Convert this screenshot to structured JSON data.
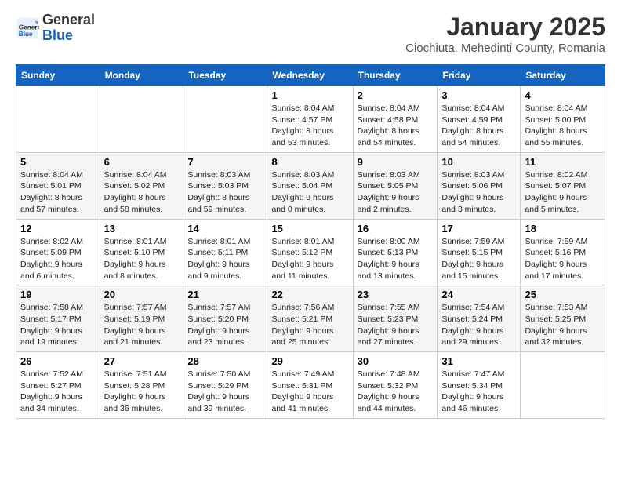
{
  "header": {
    "logo_line1": "General",
    "logo_line2": "Blue",
    "title": "January 2025",
    "subtitle": "Ciochiuta, Mehedinti County, Romania"
  },
  "days_of_week": [
    "Sunday",
    "Monday",
    "Tuesday",
    "Wednesday",
    "Thursday",
    "Friday",
    "Saturday"
  ],
  "weeks": [
    [
      {
        "day": "",
        "info": ""
      },
      {
        "day": "",
        "info": ""
      },
      {
        "day": "",
        "info": ""
      },
      {
        "day": "1",
        "info": "Sunrise: 8:04 AM\nSunset: 4:57 PM\nDaylight: 8 hours\nand 53 minutes."
      },
      {
        "day": "2",
        "info": "Sunrise: 8:04 AM\nSunset: 4:58 PM\nDaylight: 8 hours\nand 54 minutes."
      },
      {
        "day": "3",
        "info": "Sunrise: 8:04 AM\nSunset: 4:59 PM\nDaylight: 8 hours\nand 54 minutes."
      },
      {
        "day": "4",
        "info": "Sunrise: 8:04 AM\nSunset: 5:00 PM\nDaylight: 8 hours\nand 55 minutes."
      }
    ],
    [
      {
        "day": "5",
        "info": "Sunrise: 8:04 AM\nSunset: 5:01 PM\nDaylight: 8 hours\nand 57 minutes."
      },
      {
        "day": "6",
        "info": "Sunrise: 8:04 AM\nSunset: 5:02 PM\nDaylight: 8 hours\nand 58 minutes."
      },
      {
        "day": "7",
        "info": "Sunrise: 8:03 AM\nSunset: 5:03 PM\nDaylight: 8 hours\nand 59 minutes."
      },
      {
        "day": "8",
        "info": "Sunrise: 8:03 AM\nSunset: 5:04 PM\nDaylight: 9 hours\nand 0 minutes."
      },
      {
        "day": "9",
        "info": "Sunrise: 8:03 AM\nSunset: 5:05 PM\nDaylight: 9 hours\nand 2 minutes."
      },
      {
        "day": "10",
        "info": "Sunrise: 8:03 AM\nSunset: 5:06 PM\nDaylight: 9 hours\nand 3 minutes."
      },
      {
        "day": "11",
        "info": "Sunrise: 8:02 AM\nSunset: 5:07 PM\nDaylight: 9 hours\nand 5 minutes."
      }
    ],
    [
      {
        "day": "12",
        "info": "Sunrise: 8:02 AM\nSunset: 5:09 PM\nDaylight: 9 hours\nand 6 minutes."
      },
      {
        "day": "13",
        "info": "Sunrise: 8:01 AM\nSunset: 5:10 PM\nDaylight: 9 hours\nand 8 minutes."
      },
      {
        "day": "14",
        "info": "Sunrise: 8:01 AM\nSunset: 5:11 PM\nDaylight: 9 hours\nand 9 minutes."
      },
      {
        "day": "15",
        "info": "Sunrise: 8:01 AM\nSunset: 5:12 PM\nDaylight: 9 hours\nand 11 minutes."
      },
      {
        "day": "16",
        "info": "Sunrise: 8:00 AM\nSunset: 5:13 PM\nDaylight: 9 hours\nand 13 minutes."
      },
      {
        "day": "17",
        "info": "Sunrise: 7:59 AM\nSunset: 5:15 PM\nDaylight: 9 hours\nand 15 minutes."
      },
      {
        "day": "18",
        "info": "Sunrise: 7:59 AM\nSunset: 5:16 PM\nDaylight: 9 hours\nand 17 minutes."
      }
    ],
    [
      {
        "day": "19",
        "info": "Sunrise: 7:58 AM\nSunset: 5:17 PM\nDaylight: 9 hours\nand 19 minutes."
      },
      {
        "day": "20",
        "info": "Sunrise: 7:57 AM\nSunset: 5:19 PM\nDaylight: 9 hours\nand 21 minutes."
      },
      {
        "day": "21",
        "info": "Sunrise: 7:57 AM\nSunset: 5:20 PM\nDaylight: 9 hours\nand 23 minutes."
      },
      {
        "day": "22",
        "info": "Sunrise: 7:56 AM\nSunset: 5:21 PM\nDaylight: 9 hours\nand 25 minutes."
      },
      {
        "day": "23",
        "info": "Sunrise: 7:55 AM\nSunset: 5:23 PM\nDaylight: 9 hours\nand 27 minutes."
      },
      {
        "day": "24",
        "info": "Sunrise: 7:54 AM\nSunset: 5:24 PM\nDaylight: 9 hours\nand 29 minutes."
      },
      {
        "day": "25",
        "info": "Sunrise: 7:53 AM\nSunset: 5:25 PM\nDaylight: 9 hours\nand 32 minutes."
      }
    ],
    [
      {
        "day": "26",
        "info": "Sunrise: 7:52 AM\nSunset: 5:27 PM\nDaylight: 9 hours\nand 34 minutes."
      },
      {
        "day": "27",
        "info": "Sunrise: 7:51 AM\nSunset: 5:28 PM\nDaylight: 9 hours\nand 36 minutes."
      },
      {
        "day": "28",
        "info": "Sunrise: 7:50 AM\nSunset: 5:29 PM\nDaylight: 9 hours\nand 39 minutes."
      },
      {
        "day": "29",
        "info": "Sunrise: 7:49 AM\nSunset: 5:31 PM\nDaylight: 9 hours\nand 41 minutes."
      },
      {
        "day": "30",
        "info": "Sunrise: 7:48 AM\nSunset: 5:32 PM\nDaylight: 9 hours\nand 44 minutes."
      },
      {
        "day": "31",
        "info": "Sunrise: 7:47 AM\nSunset: 5:34 PM\nDaylight: 9 hours\nand 46 minutes."
      },
      {
        "day": "",
        "info": ""
      }
    ]
  ]
}
